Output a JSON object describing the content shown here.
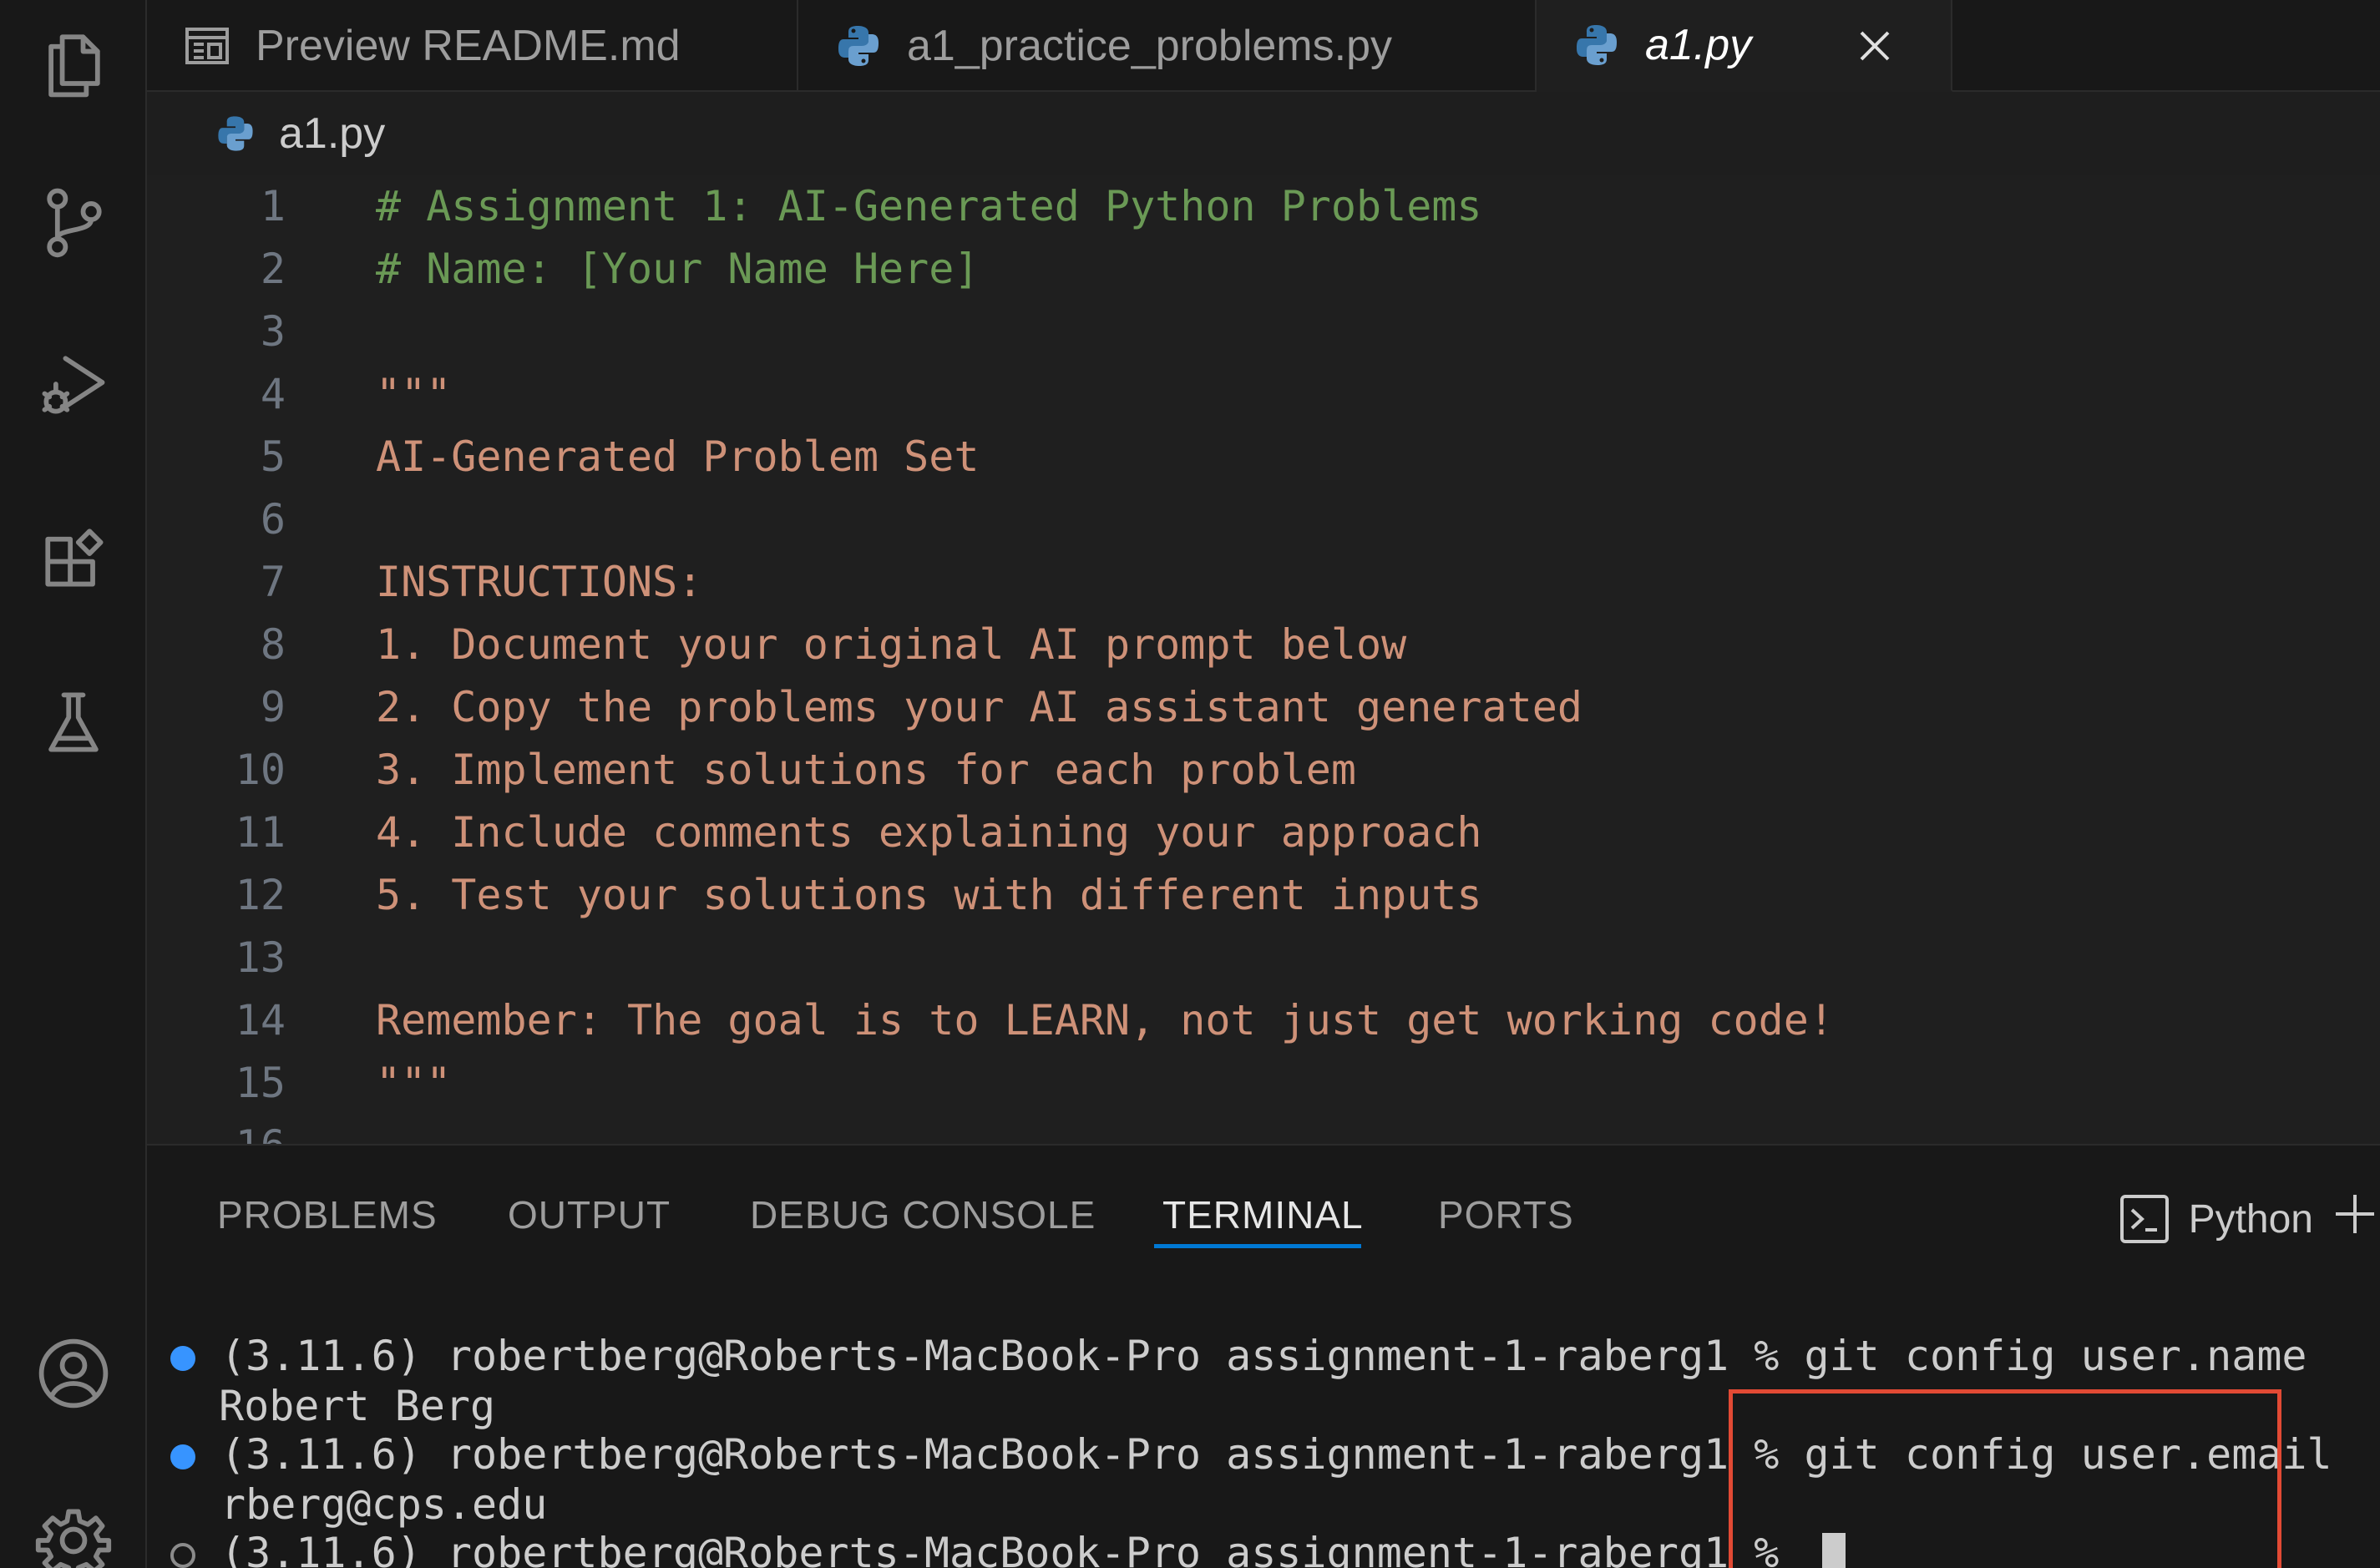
{
  "tabs": [
    {
      "label": "Preview README.md",
      "icon": "preview-icon"
    },
    {
      "label": "a1_practice_problems.py",
      "icon": "python-icon"
    },
    {
      "label": "a1.py",
      "icon": "python-icon",
      "active": true
    }
  ],
  "breadcrumb": {
    "file": "a1.py"
  },
  "editor": {
    "lines": [
      {
        "n": "1",
        "text": "# Assignment 1: AI-Generated Python Problems"
      },
      {
        "n": "2",
        "text": "# Name: [Your Name Here]"
      },
      {
        "n": "3",
        "text": ""
      },
      {
        "n": "4",
        "text": "\"\"\""
      },
      {
        "n": "5",
        "text": "AI-Generated Problem Set"
      },
      {
        "n": "6",
        "text": ""
      },
      {
        "n": "7",
        "text": "INSTRUCTIONS:"
      },
      {
        "n": "8",
        "text": "1. Document your original AI prompt below"
      },
      {
        "n": "9",
        "text": "2. Copy the problems your AI assistant generated"
      },
      {
        "n": "10",
        "text": "3. Implement solutions for each problem"
      },
      {
        "n": "11",
        "text": "4. Include comments explaining your approach"
      },
      {
        "n": "12",
        "text": "5. Test your solutions with different inputs"
      },
      {
        "n": "13",
        "text": ""
      },
      {
        "n": "14",
        "text": "Remember: The goal is to LEARN, not just get working code!"
      },
      {
        "n": "15",
        "text": "\"\"\""
      },
      {
        "n": "16",
        "text": ""
      }
    ]
  },
  "panel": {
    "tabs": [
      "PROBLEMS",
      "OUTPUT",
      "DEBUG CONSOLE",
      "TERMINAL",
      "PORTS"
    ],
    "active_tab": "TERMINAL",
    "terminal_kind": "Python"
  },
  "terminal": {
    "prompt": "(3.11.6) robertberg@Roberts-MacBook-Pro assignment-1-raberg1 % ",
    "cmd1": "git config user.name",
    "out1": "Robert Berg",
    "cmd2": "git config user.email",
    "out2": "rberg@cps.edu"
  },
  "colors": {
    "accent": "#0078d4",
    "highlight": "#e24a34",
    "comment": "#6a9955",
    "string": "#ce9178"
  }
}
